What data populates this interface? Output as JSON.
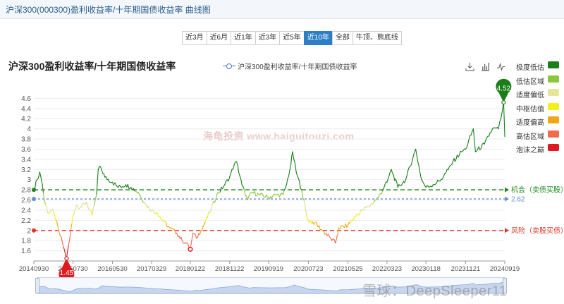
{
  "header": {
    "title": "沪深300(000300)盈利收益率/十年期国债收益率 曲线图"
  },
  "range_buttons": [
    {
      "label": "近3月",
      "active": false
    },
    {
      "label": "近6月",
      "active": false
    },
    {
      "label": "近1年",
      "active": false
    },
    {
      "label": "近3年",
      "active": false
    },
    {
      "label": "近5年",
      "active": false
    },
    {
      "label": "近10年",
      "active": true
    },
    {
      "label": "全部",
      "active": false
    },
    {
      "label": "牛顶、熊底线",
      "active": false
    }
  ],
  "zones": [
    {
      "label": "极度低估",
      "color": "#1a7f1a"
    },
    {
      "label": "低估区域",
      "color": "#8cc63f"
    },
    {
      "label": "适度偏低",
      "color": "#e6e69a"
    },
    {
      "label": "中枢估值",
      "color": "#f2ef1d"
    },
    {
      "label": "适度偏高",
      "color": "#f2a516"
    },
    {
      "label": "高估区域",
      "color": "#ee6b4d"
    },
    {
      "label": "泡沫之巅",
      "color": "#e0191e"
    }
  ],
  "toolbox": [
    {
      "name": "download-icon"
    },
    {
      "name": "bar-chart-icon"
    },
    {
      "name": "line-chart-icon"
    }
  ],
  "watermarks": {
    "site": "海龟投资 www.haiguitouzi.com",
    "author": "雪球：DeepSleeper11"
  },
  "chart_data": {
    "type": "line",
    "title": "沪深300盈利收益率/十年期国债收益率",
    "legend": "沪深300盈利收益率/十年期国债收益率",
    "ylim": [
      1.4,
      4.8
    ],
    "yticks": [
      "1.6",
      "1.8",
      "2",
      "2.2",
      "2.4",
      "2.6",
      "2.8",
      "3",
      "3.2",
      "3.4",
      "3.6",
      "3.8",
      "4",
      "4.2",
      "4.4",
      "4.6"
    ],
    "xlim": [
      "2014-09-30",
      "2024-09-19"
    ],
    "xticks": [
      "20140930",
      "20150730",
      "20160530",
      "20170329",
      "20180122",
      "20181122",
      "20190919",
      "20200723",
      "20210525",
      "20220323",
      "20230118",
      "20231121",
      "20240919"
    ],
    "series": [
      {
        "name": "沪深300盈利收益率/十年期国债收益率",
        "points": [
          [
            "2014-09-30",
            2.8
          ],
          [
            "2014-10-25",
            3.0
          ],
          [
            "2014-11-15",
            3.15
          ],
          [
            "2014-12-05",
            2.9
          ],
          [
            "2014-12-20",
            2.6
          ],
          [
            "2015-01-15",
            2.35
          ],
          [
            "2015-02-15",
            2.4
          ],
          [
            "2015-03-10",
            2.3
          ],
          [
            "2015-04-10",
            2.0
          ],
          [
            "2015-05-10",
            1.75
          ],
          [
            "2015-06-10",
            1.45
          ],
          [
            "2015-07-05",
            1.85
          ],
          [
            "2015-07-30",
            2.3
          ],
          [
            "2015-08-25",
            2.5
          ],
          [
            "2015-09-25",
            2.45
          ],
          [
            "2015-11-10",
            2.55
          ],
          [
            "2015-12-25",
            2.3
          ],
          [
            "2016-01-28",
            2.7
          ],
          [
            "2016-02-10",
            3.2
          ],
          [
            "2016-02-28",
            3.25
          ],
          [
            "2016-04-01",
            3.05
          ],
          [
            "2016-05-30",
            2.95
          ],
          [
            "2016-07-15",
            2.85
          ],
          [
            "2016-09-10",
            2.9
          ],
          [
            "2016-10-20",
            2.85
          ],
          [
            "2016-12-15",
            2.75
          ],
          [
            "2017-02-15",
            2.5
          ],
          [
            "2017-03-29",
            2.4
          ],
          [
            "2017-05-10",
            2.35
          ],
          [
            "2017-06-20",
            2.2
          ],
          [
            "2017-08-15",
            2.05
          ],
          [
            "2017-10-10",
            1.95
          ],
          [
            "2017-11-20",
            1.8
          ],
          [
            "2017-12-25",
            1.75
          ],
          [
            "2018-01-22",
            1.63
          ],
          [
            "2018-02-12",
            1.95
          ],
          [
            "2018-03-10",
            1.85
          ],
          [
            "2018-04-15",
            2.0
          ],
          [
            "2018-06-20",
            2.35
          ],
          [
            "2018-08-15",
            2.7
          ],
          [
            "2018-10-15",
            2.9
          ],
          [
            "2018-11-22",
            3.05
          ],
          [
            "2018-12-28",
            3.3
          ],
          [
            "2019-01-15",
            3.35
          ],
          [
            "2019-02-25",
            2.9
          ],
          [
            "2019-04-10",
            2.6
          ],
          [
            "2019-05-10",
            2.75
          ],
          [
            "2019-07-15",
            2.7
          ],
          [
            "2019-09-19",
            2.65
          ],
          [
            "2019-11-15",
            2.7
          ],
          [
            "2020-01-10",
            2.7
          ],
          [
            "2020-02-05",
            2.9
          ],
          [
            "2020-03-10",
            3.3
          ],
          [
            "2020-03-23",
            3.55
          ],
          [
            "2020-04-20",
            3.15
          ],
          [
            "2020-06-01",
            2.8
          ],
          [
            "2020-07-10",
            2.3
          ],
          [
            "2020-07-23",
            2.2
          ],
          [
            "2020-09-10",
            2.15
          ],
          [
            "2020-11-10",
            2.0
          ],
          [
            "2021-01-10",
            1.85
          ],
          [
            "2021-02-18",
            1.75
          ],
          [
            "2021-03-15",
            2.05
          ],
          [
            "2021-05-25",
            2.1
          ],
          [
            "2021-07-30",
            2.3
          ],
          [
            "2021-09-15",
            2.4
          ],
          [
            "2021-11-15",
            2.5
          ],
          [
            "2022-01-15",
            2.65
          ],
          [
            "2022-03-23",
            2.95
          ],
          [
            "2022-04-26",
            3.2
          ],
          [
            "2022-06-15",
            2.85
          ],
          [
            "2022-08-15",
            3.0
          ],
          [
            "2022-10-31",
            3.6
          ],
          [
            "2022-12-15",
            3.0
          ],
          [
            "2023-01-18",
            2.85
          ],
          [
            "2023-03-15",
            2.9
          ],
          [
            "2023-05-15",
            3.0
          ],
          [
            "2023-07-10",
            3.2
          ],
          [
            "2023-08-15",
            3.35
          ],
          [
            "2023-10-20",
            3.55
          ],
          [
            "2023-11-21",
            3.6
          ],
          [
            "2024-01-20",
            4.0
          ],
          [
            "2024-02-05",
            3.55
          ],
          [
            "2024-04-15",
            3.7
          ],
          [
            "2024-06-15",
            4.0
          ],
          [
            "2024-08-01",
            4.0
          ],
          [
            "2024-08-20",
            4.2
          ],
          [
            "2024-09-10",
            4.52
          ],
          [
            "2024-09-19",
            3.85
          ]
        ]
      }
    ],
    "reference_lines": [
      {
        "label": "机会（卖债买股）",
        "value": 2.8,
        "color": "#1f8a1f"
      },
      {
        "label": "2.62",
        "value": 2.62,
        "color": "#6a8ed4"
      },
      {
        "label": "风险（卖股买债）",
        "value": 2.0,
        "color": "#d9382c"
      }
    ],
    "markers": [
      {
        "label": "1.45",
        "date": "2015-06-10",
        "value": 1.45,
        "color": "#e0191e"
      },
      {
        "label": "4.52",
        "date": "2024-09-10",
        "value": 4.52,
        "color": "#1a7f1a"
      },
      {
        "date": "2018-01-22",
        "value": 1.63,
        "color": "#e0191e"
      }
    ]
  }
}
